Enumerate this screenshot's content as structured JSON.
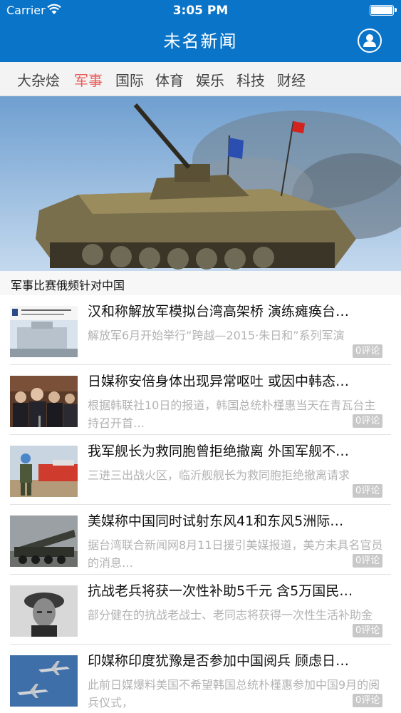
{
  "status": {
    "carrier": "Carrier",
    "time": "3:05 PM"
  },
  "nav": {
    "title": "未名新闻",
    "user_icon": "user-icon"
  },
  "tabs": [
    {
      "label": "大杂烩",
      "active": false
    },
    {
      "label": "军事",
      "active": true
    },
    {
      "label": "国际",
      "active": false
    },
    {
      "label": "体育",
      "active": false
    },
    {
      "label": "娱乐",
      "active": false
    },
    {
      "label": "科技",
      "active": false
    },
    {
      "label": "财经",
      "active": false
    }
  ],
  "hero": {
    "caption": "军事比赛俄频针对中国",
    "image": "armored-vehicle-photo"
  },
  "news": [
    {
      "title": "汉和称解放军模拟台湾高架桥 演练瘫痪台…",
      "desc": "解放军6月开始举行“跨越—2015·朱日和”系列军演",
      "comments": "0评论",
      "thumb": "military-building-thumb"
    },
    {
      "title": "日媒称安倍身体出现异常呕吐 或因中韩态…",
      "desc": "根据韩联社10日的报道，韩国总统朴槿惠当天在青瓦台主持召开首…",
      "comments": "0评论",
      "thumb": "abe-press-thumb"
    },
    {
      "title": "我军舰长为救同胞曾拒绝撤离 外国军舰不…",
      "desc": "三进三出战火区，临沂舰舰长为救同胞拒绝撤离请求",
      "comments": "0评论",
      "thumb": "soldier-thumb"
    },
    {
      "title": "美媒称中国同时试射东风41和东风5洲际…",
      "desc": "据台湾联合新闻网8月11日援引美媒报道，美方未具名官员的消息…",
      "comments": "0评论",
      "thumb": "missile-truck-thumb"
    },
    {
      "title": "抗战老兵将获一次性补助5千元 含5万国民…",
      "desc": "部分健在的抗战老战士、老同志将获得一次性生活补助金",
      "comments": "0评论",
      "thumb": "veteran-portrait-thumb"
    },
    {
      "title": "印媒称印度犹豫是否参加中国阅兵 顾虑日…",
      "desc": "此前日媒爆料美国不希望韩国总统朴槿惠参加中国9月的阅兵仪式，",
      "comments": "0评论",
      "thumb": "jets-thumb"
    }
  ]
}
